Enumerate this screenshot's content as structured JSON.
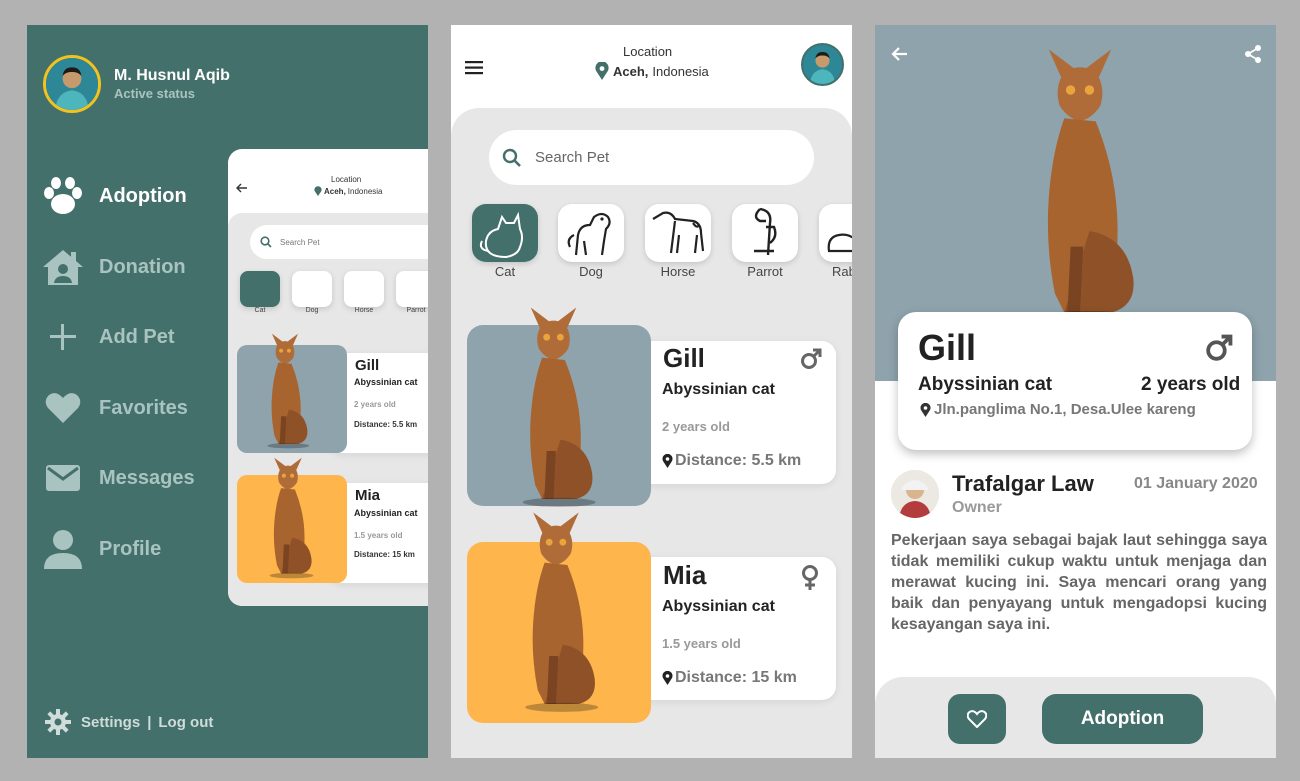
{
  "drawer": {
    "user_name": "M. Husnul Aqib",
    "user_status": "Active status",
    "menu": [
      {
        "label": "Adoption",
        "icon": "paw-icon",
        "active": true
      },
      {
        "label": "Donation",
        "icon": "home-heart-icon",
        "active": false
      },
      {
        "label": "Add Pet",
        "icon": "plus-icon",
        "active": false
      },
      {
        "label": "Favorites",
        "icon": "heart-icon",
        "active": false
      },
      {
        "label": "Messages",
        "icon": "mail-icon",
        "active": false
      },
      {
        "label": "Profile",
        "icon": "person-icon",
        "active": false
      }
    ],
    "settings_label": "Settings",
    "separator": "|",
    "logout_label": "Log out"
  },
  "home": {
    "location_label": "Location",
    "location_city": "Aceh,",
    "location_country": "Indonesia",
    "search_placeholder": "Search Pet",
    "categories": [
      {
        "label": "Cat",
        "icon": "cat-icon",
        "selected": true
      },
      {
        "label": "Dog",
        "icon": "dog-icon",
        "selected": false
      },
      {
        "label": "Horse",
        "icon": "horse-icon",
        "selected": false
      },
      {
        "label": "Parrot",
        "icon": "parrot-icon",
        "selected": false
      },
      {
        "label": "Rab",
        "icon": "rabbit-icon",
        "selected": false
      }
    ],
    "pets": [
      {
        "name": "Gill",
        "breed": "Abyssinian cat",
        "age": "2 years old",
        "distance": "Distance: 5.5 km",
        "gender": "male",
        "bg": "#8fa3ad"
      },
      {
        "name": "Mia",
        "breed": "Abyssinian cat",
        "age": "1.5 years old",
        "distance": "Distance: 15 km",
        "gender": "female",
        "bg": "#fdb54c"
      }
    ]
  },
  "mini_preview": {
    "pets": [
      {
        "name": "Gill",
        "breed": "Abyssinian cat",
        "age": "2 years old",
        "distance": "Distance: 5.5 km"
      },
      {
        "name": "Mia",
        "breed": "Abyssinian cat",
        "age": "1.5 years old",
        "distance": "Distance: 15 km"
      }
    ]
  },
  "detail": {
    "name": "Gill",
    "breed": "Abyssinian cat",
    "age": "2 years old",
    "address": "Jln.panglima No.1, Desa.Ulee kareng",
    "owner_name": "Trafalgar Law",
    "owner_role": "Owner",
    "date": "01 January 2020",
    "story": "Pekerjaan saya sebagai bajak laut sehingga saya tidak memiliki cukup waktu untuk menjaga dan merawat kucing ini. Saya mencari orang yang baik dan penyayang untuk mengadopsi kucing kesayangan saya ini.",
    "adopt_label": "Adoption"
  },
  "colors": {
    "primary": "#44706b",
    "background": "#b2b2b2",
    "card_grey": "#8fa3ad",
    "card_orange": "#fdb54c",
    "panel": "#e7e7e7"
  }
}
